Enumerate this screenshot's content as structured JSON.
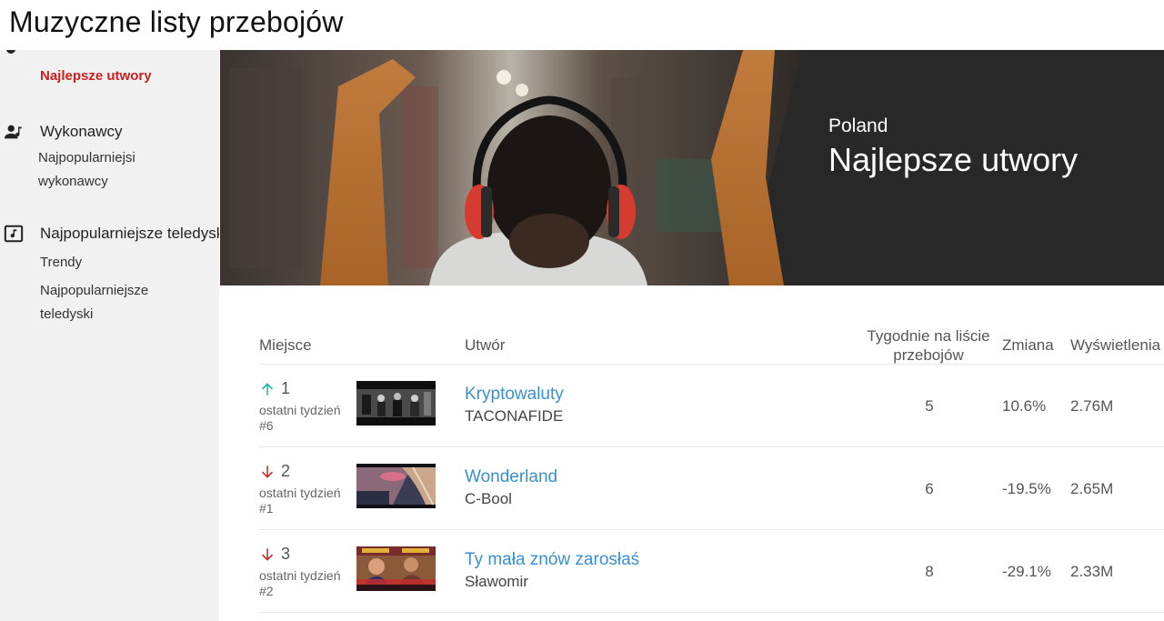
{
  "app": {
    "title": "Muzyczne listy przebojów"
  },
  "sidebar": {
    "active_item": "Najlepsze utwory",
    "sections": [
      {
        "label": "Wykonawcy",
        "icon": "artist-icon",
        "items": [
          "Najpopularniejsi wykonawcy"
        ]
      },
      {
        "label": "Najpopularniejsze teledyski",
        "icon": "music-video-icon",
        "items": [
          "Trendy",
          "Najpopularniejsze teledyski"
        ]
      }
    ]
  },
  "hero": {
    "country": "Poland",
    "title": "Najlepsze utwory"
  },
  "table": {
    "headers": {
      "rank": "Miejsce",
      "track": "Utwór",
      "weeks": "Tygodnie na liście przebojów",
      "change": "Zmiana",
      "views": "Wyświetlenia"
    },
    "rows": [
      {
        "rank": "1",
        "direction": "up",
        "last_week_label": "ostatni tydzień",
        "last_week": "#6",
        "title": "Kryptowaluty",
        "artist": "TACONAFIDE",
        "weeks": "5",
        "change": "10.6%",
        "views": "2.76M"
      },
      {
        "rank": "2",
        "direction": "down",
        "last_week_label": "ostatni tydzień",
        "last_week": "#1",
        "title": "Wonderland",
        "artist": "C-Bool",
        "weeks": "6",
        "change": "-19.5%",
        "views": "2.65M"
      },
      {
        "rank": "3",
        "direction": "down",
        "last_week_label": "ostatni tydzień",
        "last_week": "#2",
        "title": "Ty mała znów zarosłaś",
        "artist": "Sławomir",
        "weeks": "8",
        "change": "-29.1%",
        "views": "2.33M"
      }
    ]
  },
  "colors": {
    "accent_red": "#cc1f1f",
    "link_blue": "#3a8fd0",
    "up_teal": "#1ab2a5",
    "down_red": "#c62828",
    "hero_dark": "#282828"
  }
}
